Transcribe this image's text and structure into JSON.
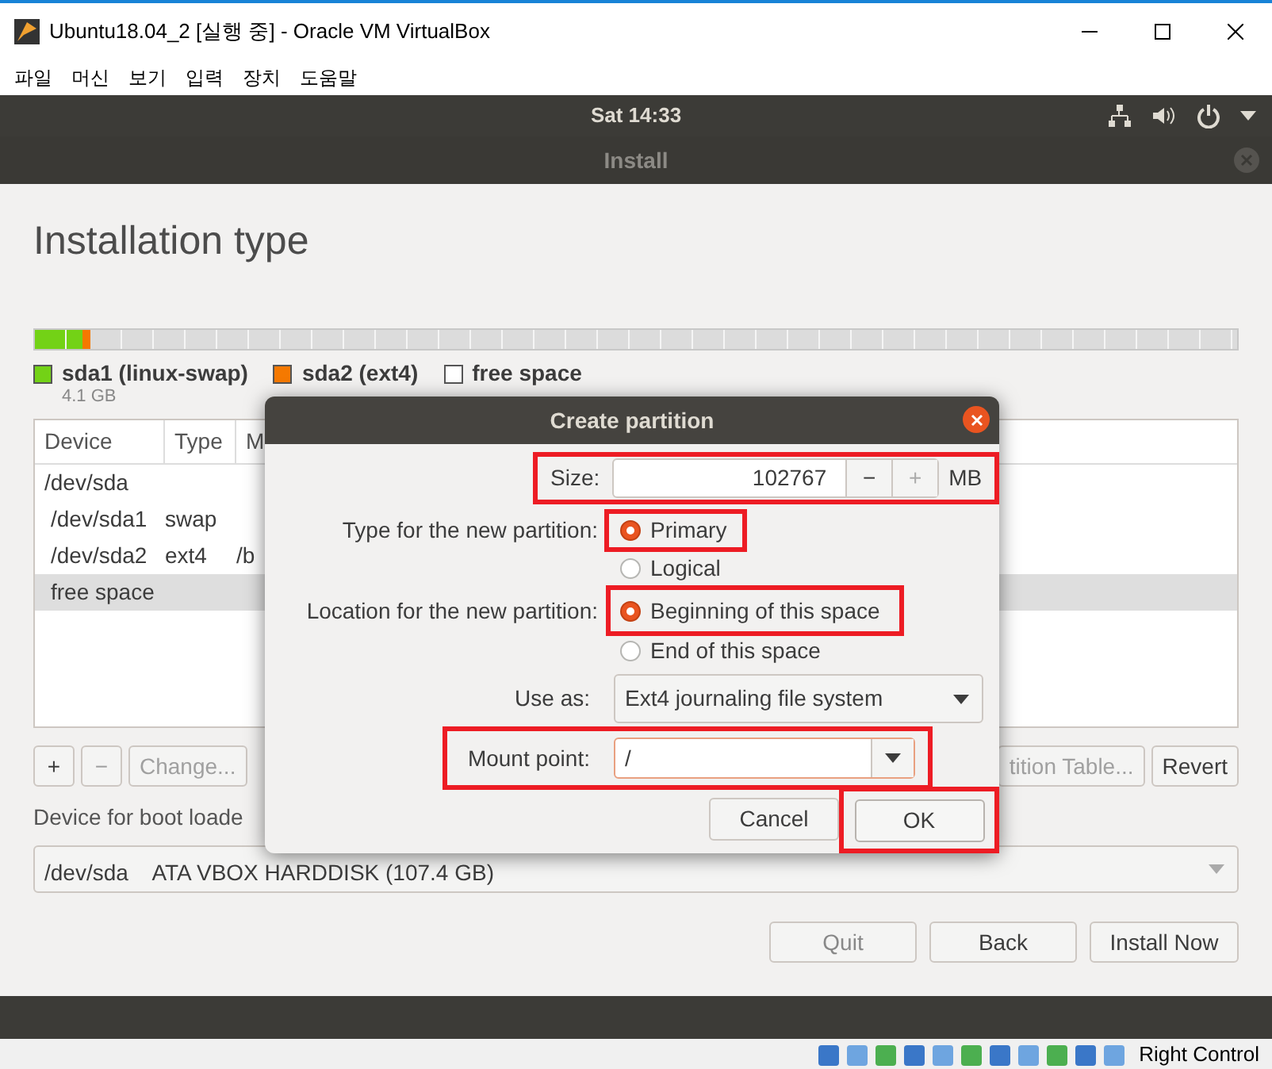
{
  "window": {
    "title": "Ubuntu18.04_2 [실행 중] - Oracle VM VirtualBox"
  },
  "menu": [
    "파일",
    "머신",
    "보기",
    "입력",
    "장치",
    "도움말"
  ],
  "top_bar": {
    "clock": "Sat 14:33"
  },
  "installer": {
    "title": "Install",
    "heading": "Installation type",
    "partition_bar": [
      {
        "level": 0.04,
        "color": "#73d216"
      },
      {
        "level": 0.006,
        "color": "#f57900"
      },
      {
        "level": 0.954,
        "color": "#dcdcdc"
      }
    ],
    "legend": [
      {
        "name": "sda1 (linux-swap)",
        "size": "4.1 GB",
        "color": "#73d216"
      },
      {
        "name": "sda2 (ext4)",
        "color": "#f57900"
      },
      {
        "name": "free space",
        "color": "#ffffff"
      }
    ],
    "table": {
      "columns": [
        "Device",
        "Type",
        "M"
      ],
      "rows": [
        {
          "device": "/dev/sda",
          "selected": false,
          "children": [
            {
              "device": "/dev/sda1",
              "type": "swap",
              "selected": false
            },
            {
              "device": "/dev/sda2",
              "type": "ext4",
              "mount": "/b",
              "selected": false
            },
            {
              "device": "free space",
              "selected": true
            }
          ]
        }
      ]
    },
    "table_buttons": [
      {
        "label": "+",
        "disabled": false
      },
      {
        "label": "−",
        "disabled": true
      },
      {
        "label": "Change...",
        "disabled": true
      }
    ],
    "right_buttons": [
      "tition Table...",
      "Revert"
    ],
    "boot_loader_label": "Device for boot loade",
    "boot_device": "/dev/sda    ATA VBOX HARDDISK (107.4 GB)",
    "nav_buttons": [
      {
        "label": "Quit",
        "disabled": true
      },
      {
        "label": "Back",
        "disabled": false
      },
      {
        "label": "Install Now",
        "disabled": false
      }
    ]
  },
  "dialog": {
    "title": "Create partition",
    "size": {
      "label": "Size:",
      "value": "102767",
      "unit": "MB",
      "minus": "−",
      "plus": "+"
    },
    "type": {
      "label": "Type for the new partition:",
      "options": [
        {
          "label": "Primary",
          "selected": true
        },
        {
          "label": "Logical",
          "selected": false
        }
      ]
    },
    "location": {
      "label": "Location for the new partition:",
      "options": [
        {
          "label": "Beginning of this space",
          "selected": true
        },
        {
          "label": "End of this space",
          "selected": false
        }
      ]
    },
    "use_as": {
      "label": "Use as:",
      "value": "Ext4 journaling file system"
    },
    "mount_point": {
      "label": "Mount point:",
      "value": "/"
    },
    "buttons": [
      {
        "label": "Cancel",
        "kind": "secondary"
      },
      {
        "label": "OK",
        "kind": "primary"
      }
    ]
  },
  "status_bar": {
    "host_key": "Right Control"
  }
}
